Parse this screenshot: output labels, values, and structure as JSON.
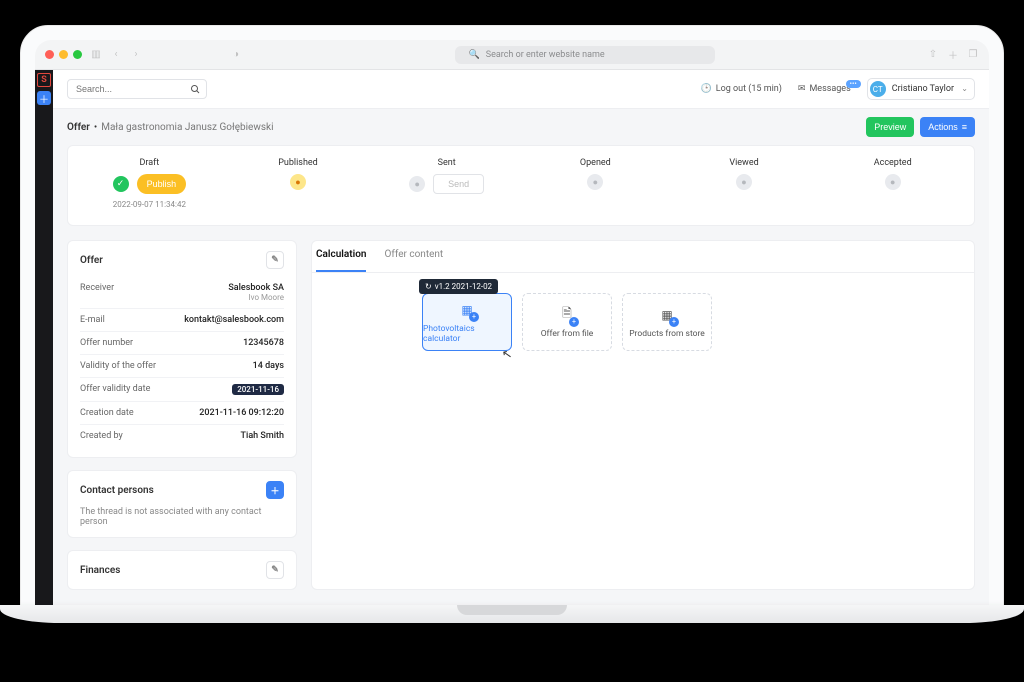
{
  "safari": {
    "placeholder": "Search or enter website name"
  },
  "topbar": {
    "search_placeholder": "Search...",
    "logout_label": "Log out (15 min)",
    "messages_label": "Messages",
    "user": {
      "initials": "CT",
      "name": "Cristiano Taylor"
    }
  },
  "header": {
    "section": "Offer",
    "breadcrumb": "Mała gastronomia Janusz Gołębiewski",
    "preview_label": "Preview",
    "actions_label": "Actions"
  },
  "pipeline": {
    "stages": [
      "Draft",
      "Published",
      "Sent",
      "Opened",
      "Viewed",
      "Accepted"
    ],
    "draft_timestamp": "2022-09-07 11:34:42",
    "publish_label": "Publish",
    "send_label": "Send"
  },
  "offer_card": {
    "title": "Offer",
    "rows": [
      {
        "label": "Receiver",
        "value": "Salesbook SA",
        "sub": "Ivo Moore"
      },
      {
        "label": "E-mail",
        "value": "kontakt@salesbook.com"
      },
      {
        "label": "Offer number",
        "value": "12345678"
      },
      {
        "label": "Validity of the offer",
        "value": "14 days"
      },
      {
        "label": "Offer validity date",
        "value": "2021-11-16",
        "tag": true
      },
      {
        "label": "Creation date",
        "value": "2021-11-16 09:12:20"
      },
      {
        "label": "Created by",
        "value": "Tiah Smith"
      }
    ]
  },
  "contacts_card": {
    "title": "Contact persons",
    "empty": "The thread is not associated with any contact person"
  },
  "finances_card": {
    "title": "Finances"
  },
  "right": {
    "tabs": [
      "Calculation",
      "Offer content"
    ],
    "tiles": [
      "Photovoltaics calculator",
      "Offer from file",
      "Products from store"
    ],
    "tooltip": "v1.2  2021-12-02"
  }
}
